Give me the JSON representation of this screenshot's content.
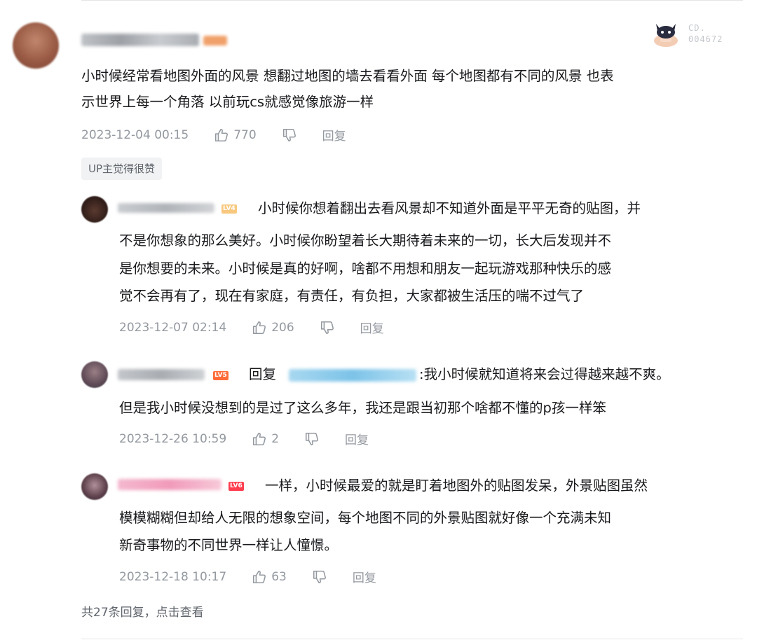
{
  "top_comment": {
    "text_lines": [
      "小时候经常看地图外面的风景 想翻过地图的墙去看看外面 每个地图都有不同的风景 也表",
      "示世界上每一个角落 以前玩cs就感觉像旅游一样"
    ],
    "date": "2023-12-04 00:15",
    "likes": "770",
    "reply_label": "回复",
    "up_badge": "UP主觉得很赞",
    "sticker": {
      "line1": "CD.",
      "line2": "004672"
    }
  },
  "replies": [
    {
      "level": "LV4",
      "text_lines": [
        "小时候你想着翻出去看风景却不知道外面是平平无奇的贴图，并",
        "不是你想象的那么美好。小时候你盼望着长大期待着未来的一切，长大后发现并不",
        "是你想要的未来。小时候是真的好啊，啥都不用想和朋友一起玩游戏那种快乐的感",
        "觉不会再有了，现在有家庭，有责任，有负担，大家都被生活压的喘不过气了"
      ],
      "date": "2023-12-07 02:14",
      "likes": "206",
      "reply_label": "回复"
    },
    {
      "level": "LV5",
      "reply_prefix": "回复",
      "text_lines": [
        ":我小时候就知道将来会过得越来越不爽。",
        "但是我小时候没想到的是过了这么多年，我还是跟当初那个啥都不懂的p孩一样笨"
      ],
      "date": "2023-12-26 10:59",
      "likes": "2",
      "reply_label": "回复"
    },
    {
      "level": "LV6",
      "text_lines": [
        "一样，小时候最爱的就是盯着地图外的贴图发呆，外景贴图虽然",
        "模模糊糊但却给人无限的想象空间，每个地图不同的外景贴图就好像一个充满未知",
        "新奇事物的不同世界一样让人憧憬。"
      ],
      "date": "2023-12-18 10:17",
      "likes": "63",
      "reply_label": "回复"
    }
  ],
  "footer": {
    "more_replies": "共27条回复，点击查看"
  },
  "colors": {
    "text": "#18191c",
    "meta": "#9499a0",
    "badge_bg": "#f1f2f3"
  }
}
